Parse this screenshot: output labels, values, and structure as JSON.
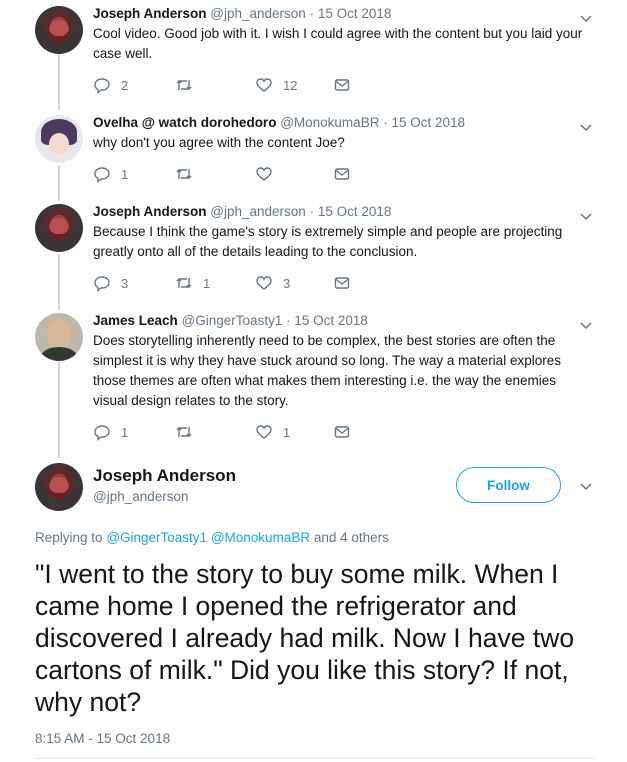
{
  "replies": [
    {
      "name": "Joseph Anderson",
      "handle": "@jph_anderson",
      "date": "15 Oct 2018",
      "text": "Cool video. Good job with it. I wish I could agree with the content but you laid your case well.",
      "reply_count": "2",
      "retweet_count": "",
      "like_count": "12"
    },
    {
      "name": "Ovelha @ watch dorohedoro",
      "handle": "@MonokumaBR",
      "date": "15 Oct 2018",
      "text": "why don't you agree with the content Joe?",
      "reply_count": "1",
      "retweet_count": "",
      "like_count": ""
    },
    {
      "name": "Joseph Anderson",
      "handle": "@jph_anderson",
      "date": "15 Oct 2018",
      "text": "Because I think the game's story is extremely simple and people are projecting greatly onto all of the details leading to the conclusion.",
      "reply_count": "3",
      "retweet_count": "1",
      "like_count": "3"
    },
    {
      "name": "James Leach",
      "handle": "@GingerToasty1",
      "date": "15 Oct 2018",
      "text": "Does storytelling inherently need to be complex, the best stories are often the simplest it is why they have stuck around so long. The way a material explores those themes are often what makes them interesting i.e. the way the enemies visual design relates to the story.",
      "reply_count": "1",
      "retweet_count": "",
      "like_count": "1"
    }
  ],
  "separator": "·",
  "main_tweet": {
    "name": "Joseph Anderson",
    "handle": "@jph_anderson",
    "follow_label": "Follow",
    "replying_prefix": "Replying to",
    "replying_user1": "@GingerToasty1",
    "replying_user2": "@MonokumaBR",
    "replying_suffix": "and 4 others",
    "text": "\"I went to the story to buy some milk. When I came home I opened the refrigerator and discovered I already had milk. Now I have two cartons of milk.\" Did you like this story? If not, why not?",
    "timestamp": "8:15 AM - 15 Oct 2018"
  },
  "colors": {
    "accent": "#1da1f2",
    "muted": "#657786",
    "text": "#14171a",
    "thread_line": "#ccd6dd"
  },
  "icons": [
    "reply-icon",
    "retweet-icon",
    "like-icon",
    "dm-icon",
    "chevron-down-icon"
  ]
}
